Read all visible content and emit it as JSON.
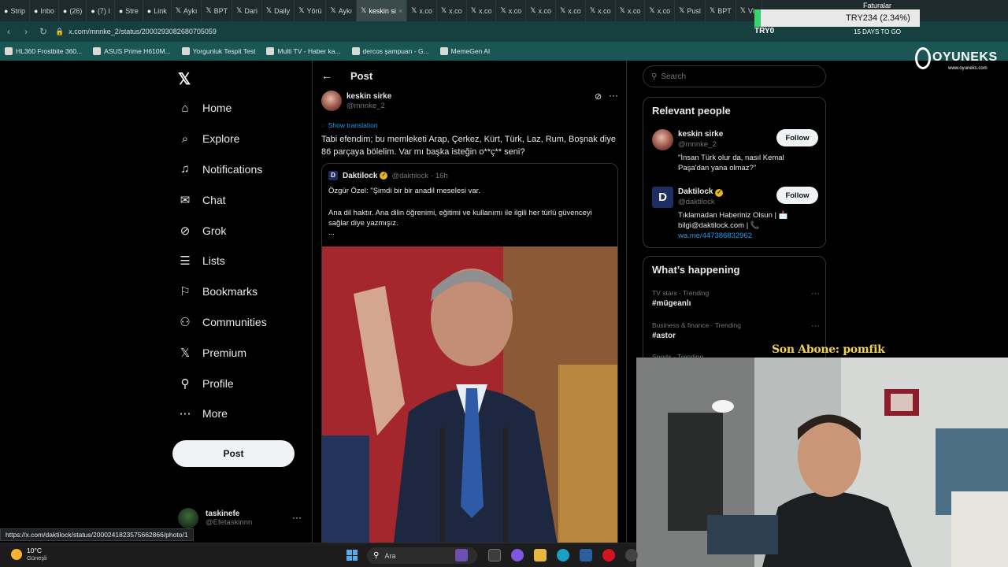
{
  "browser": {
    "tabs": [
      {
        "label": "Strip",
        "icon": "opera-icon"
      },
      {
        "label": "Inbo",
        "icon": "mail-icon"
      },
      {
        "label": "(26)",
        "icon": "chat-icon"
      },
      {
        "label": "(7) I",
        "icon": "instagram-icon"
      },
      {
        "label": "Stre",
        "icon": "kick-icon"
      },
      {
        "label": "Link",
        "icon": "link-icon"
      },
      {
        "label": "Aykı",
        "icon": "x-icon"
      },
      {
        "label": "BPT",
        "icon": "x-icon"
      },
      {
        "label": "Dari",
        "icon": "x-icon"
      },
      {
        "label": "Daily",
        "icon": "x-icon"
      },
      {
        "label": "Yörü",
        "icon": "x-icon"
      },
      {
        "label": "Aykı",
        "icon": "x-icon"
      },
      {
        "label": "keskin si",
        "icon": "x-icon",
        "active": true
      },
      {
        "label": "x.co",
        "icon": "x-icon"
      },
      {
        "label": "x.co",
        "icon": "x-icon"
      },
      {
        "label": "x.co",
        "icon": "x-icon"
      },
      {
        "label": "x.co",
        "icon": "x-icon"
      },
      {
        "label": "x.co",
        "icon": "x-icon"
      },
      {
        "label": "x.co",
        "icon": "x-icon"
      },
      {
        "label": "x.co",
        "icon": "x-icon"
      },
      {
        "label": "x.co",
        "icon": "x-icon"
      },
      {
        "label": "x.co",
        "icon": "x-icon"
      },
      {
        "label": "Pusl",
        "icon": "x-icon"
      },
      {
        "label": "BPT",
        "icon": "x-icon"
      },
      {
        "label": "Vis",
        "icon": "x-icon"
      }
    ],
    "url": "x.com/mnnke_2/status/2000293082680705059",
    "bookmarks": [
      "HL360 Frostbite 360...",
      "ASUS Prime H610M...",
      "Yorgunluk Tespit Test",
      "Multi TV - Haber ka...",
      "dercos şampuan - G...",
      "MemeGen AI"
    ],
    "status_url": "https://x.com/daktilock/status/2000241823575662866/photo/1"
  },
  "overlay": {
    "stock": "TRY234 (2.34%)",
    "try0": "TRY0",
    "faturalar": "Faturalar",
    "days": "15 DAYS TO GO",
    "brand": "OYUNEKS",
    "brand_url": "www.oyuneks.com",
    "subscriber": "Son Abone: pomfik"
  },
  "sidebar": {
    "items": [
      {
        "label": "Home",
        "icon": "home-icon",
        "glyph": "⌂"
      },
      {
        "label": "Explore",
        "icon": "search-icon",
        "glyph": "⌕"
      },
      {
        "label": "Notifications",
        "icon": "bell-icon",
        "glyph": "♫"
      },
      {
        "label": "Chat",
        "icon": "mail-icon",
        "glyph": "✉"
      },
      {
        "label": "Grok",
        "icon": "grok-icon",
        "glyph": "⊘"
      },
      {
        "label": "Lists",
        "icon": "list-icon",
        "glyph": "☰"
      },
      {
        "label": "Bookmarks",
        "icon": "bookmark-icon",
        "glyph": "⚐"
      },
      {
        "label": "Communities",
        "icon": "people-icon",
        "glyph": "⚇"
      },
      {
        "label": "Premium",
        "icon": "x-icon",
        "glyph": "𝕏"
      },
      {
        "label": "Profile",
        "icon": "person-icon",
        "glyph": "⚲"
      },
      {
        "label": "More",
        "icon": "more-icon",
        "glyph": "⋯"
      }
    ],
    "post_button": "Post",
    "account": {
      "name": "taskinefe",
      "handle": "@Efetaskinnn"
    }
  },
  "post": {
    "header": "Post",
    "author": {
      "name": "keskin sirke",
      "handle": "@mnnke_2"
    },
    "show_translation": "Show translation",
    "text": "Tabi efendim; bu memleketi Arap, Çerkez, Kürt, Türk, Laz, Rum, Boşnak diye 86 parçaya bölelim. Var mı başka isteğin o**ç** seni?",
    "quote": {
      "author": "Daktilock",
      "handle": "@daktilock",
      "time": "· 16h",
      "line1": "Özgür Özel: \"Şimdi bir bir anadil meselesi var.",
      "line2": "Ana dil haktır. Ana dilin öğrenimi, eğitimi ve kullanımı ile ilgili her türlü güvenceyi sağlar diye yazmışız.",
      "line3": "..."
    }
  },
  "right": {
    "search_placeholder": "Search",
    "relevant_title": "Relevant people",
    "people": [
      {
        "name": "keskin sirke",
        "handle": "@mnnke_2",
        "bio": "\"İnsan Türk olur da, nasıl Kemal Paşa'dan yana olmaz?\"",
        "link": "",
        "follow": "Follow"
      },
      {
        "name": "Daktilock",
        "handle": "@daktilock",
        "bio": "Tıklamadan Haberiniz Olsun | 📩 bilgi@daktilock.com | 📞",
        "link": "wa.me/447386832962",
        "follow": "Follow"
      }
    ],
    "happening_title": "What’s happening",
    "trends": [
      {
        "category": "TV stars · Trending",
        "topic": "#mügeanlı"
      },
      {
        "category": "Business & finance · Trending",
        "topic": "#astor"
      },
      {
        "category": "Sports · Trending",
        "topic": ""
      }
    ]
  },
  "taskbar": {
    "temp": "10°C",
    "weather": "Güneşli",
    "search": "Ara"
  }
}
